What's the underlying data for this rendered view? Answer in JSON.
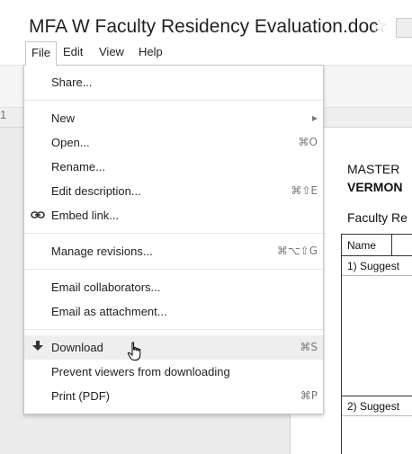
{
  "window": {
    "doc_title": "MFA W Faculty Residency Evaluation.doc",
    "star_glyph": "☆"
  },
  "menubar": {
    "file": "File",
    "edit": "Edit",
    "view": "View",
    "help": "Help"
  },
  "ruler": {
    "mark": "1"
  },
  "file_menu": {
    "share": "Share...",
    "new": "New",
    "new_arrow": "▸",
    "open": "Open...",
    "open_shortcut": "⌘O",
    "rename": "Rename...",
    "edit_description": "Edit description...",
    "edit_description_shortcut": "⌘⇧E",
    "embed_link": "Embed link...",
    "manage_revisions": "Manage revisions...",
    "manage_revisions_shortcut": "⌘⌥⇧G",
    "email_collaborators": "Email collaborators...",
    "email_attachment": "Email as attachment...",
    "download": "Download",
    "download_shortcut": "⌘S",
    "prevent_download": "Prevent viewers from downloading",
    "print": "Print (PDF)",
    "print_shortcut": "⌘P"
  },
  "document": {
    "line1": "MASTER",
    "line2": "VERMON",
    "line3": "Faculty Re",
    "table": {
      "name_header": "Name",
      "q1": "1)  Suggest",
      "q2": "2)  Suggest"
    }
  },
  "colors": {
    "menu_hover": "#eeeeee",
    "toolbar_bg": "#f5f5f5",
    "canvas_bg": "#ebebeb"
  }
}
